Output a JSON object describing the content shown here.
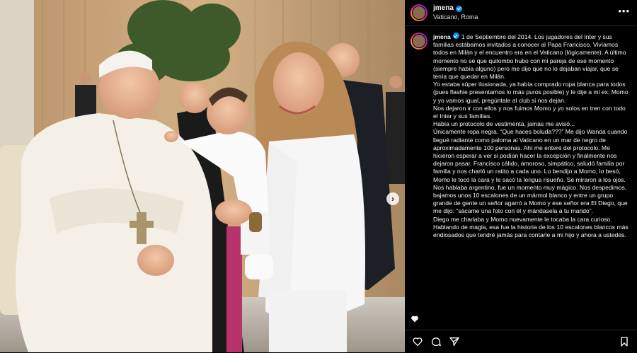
{
  "post": {
    "username": "jmena",
    "location": "Vaticano, Roma",
    "more_label": "•••",
    "caption": "1 de Septiembre del 2014. Los jugadores del Inter y sus familias estábamos invitados a conocer al Papa Francisco. Vivíamos todos en Milán y el encuentro era en el Vaticano (lógicamente). A último momento no sé que quilombo hubo con mi pareja de ese momento (siempre había alguno) pero me dijo que no lo dejaban viajar, que se tenía que quedar en Milán.\nYo estaba súper ilusionada, ya había comprado ropa blanca para todos (pues flashie presentarnos lo más puros posible) y le dije a mi ex: Momo y yo vamos igual, pregúntale al club si nos dejan.\nNos dejaron ir con ellos y nos fuimos Momo y yo solos en tren con todo el Inter y sus familias.\nHabía un protocolo de vestimenta, jamás me avisó...\nÚnicamente ropa negra. “Que haces boluda???” Me dijo Wanda cuando llegué radiante como paloma al Vaticano en un mar de negro de aproximadamente 100 personas. Ahí me enteré del protocolo. Me hicieron esperar a ver si podían hacer la excepción y finalmente nos dejaron pasar. Francisco cálido, amoroso, simpático, saludó familia por familia y nos charló un ratito a cada uno. Lo bendijo a Momo, lo besó, Momo le tocó la cara y le sacó la lengua risueño. Se miraron a los ojos. Nos hablaba argentino, fue un momento muy mágico. Nos despedimos, bajamos unos 10 escalones de un mármol blanco y entre un grupo grande de gente un señor agarró a Momo y ese señor era El Diego, que me dijo: “sácame una foto con él y mándasela a tu marido”.\nDiego me charlaba y Momo nuevamente le tocaba la cara curioso.\nHablando de magia, esa fue la historia de los 10 escalones blancos más endiosados que tendré jamás para contarle a mi hijo y ahora a ustedes."
  },
  "icons": {
    "verified": "verified-badge-icon",
    "more": "more-options-icon",
    "next": "chevron-right-icon",
    "heart": "heart-icon",
    "comment": "comment-icon",
    "share": "share-icon",
    "save": "bookmark-icon"
  },
  "colors": {
    "background": "#000000",
    "text": "#f5f5f5",
    "verified": "#0095f6",
    "divider": "#262626"
  }
}
